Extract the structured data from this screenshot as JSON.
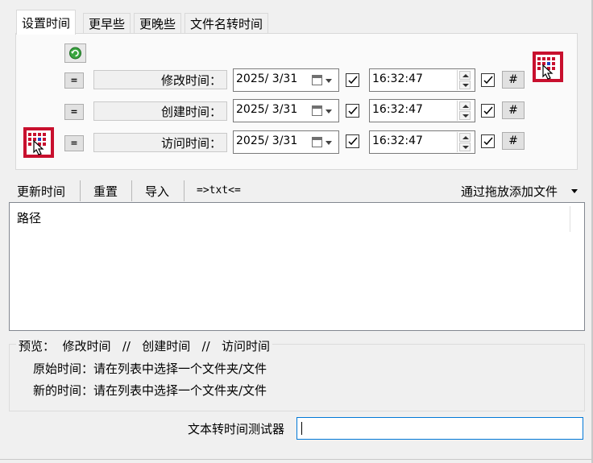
{
  "tabs": [
    "设置时间",
    "更早些",
    "更晚些",
    "文件名转时间"
  ],
  "rows": [
    {
      "label": "修改时间：",
      "date": "2025/  3/31",
      "time": "16:32:47",
      "button": "=",
      "hash": "#"
    },
    {
      "label": "创建时间：",
      "date": "2025/  3/31",
      "time": "16:32:47",
      "button": "=",
      "hash": "#"
    },
    {
      "label": "访问时间：",
      "date": "2025/  3/31",
      "time": "16:32:47",
      "button": "=",
      "hash": "#"
    }
  ],
  "toolbar": {
    "update": "更新时间",
    "reset": "重置",
    "import": "导入",
    "txt": "=>txt<=",
    "add_by_drag": "通过拖放添加文件"
  },
  "list": {
    "column": "路径"
  },
  "preview": {
    "legend": "预览：  修改时间   //   创建时间   //   访问时间",
    "original": "原始时间：请在列表中选择一个文件夹/文件",
    "new": "新的时间：请在列表中选择一个文件夹/文件"
  },
  "tester": {
    "label": "文本转时间测试器",
    "value": ""
  },
  "icons": {
    "refresh": "green-refresh-icon",
    "calendar_pointer": "calendar-pointer-icon",
    "calendar": "calendar-icon",
    "checkmark": "checkmark-icon",
    "dropdown": "dropdown-arrow-icon"
  },
  "colors": {
    "accent": "#0078d7",
    "icon_red": "#c8102e",
    "icon_blue": "#1f3fbf"
  }
}
